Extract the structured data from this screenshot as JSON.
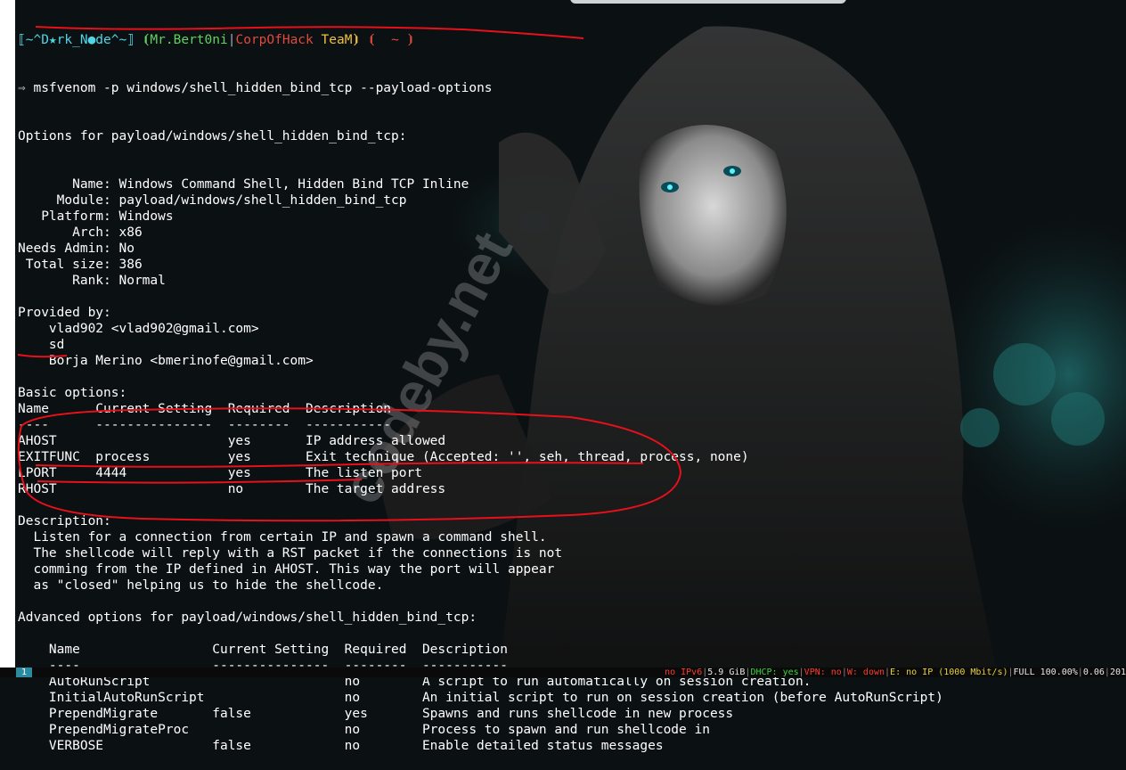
{
  "prompt": {
    "left_bracket": "⟦",
    "host": "~^D★rk_N●de^~",
    "right_bracket": "⟧",
    "user": "⦗Mr.Bert0ni",
    "team_sep": "|",
    "team": "CorpOfHack",
    "team2": " TeaM⦘",
    "cwd": " ⦗  ~ ⦘"
  },
  "command": {
    "arrow": "⇒",
    "text": "msfvenom -p windows/shell_hidden_bind_tcp --payload-options"
  },
  "lines": [
    "Options for payload/windows/shell_hidden_bind_tcp:",
    "",
    "",
    "       Name: Windows Command Shell, Hidden Bind TCP Inline",
    "     Module: payload/windows/shell_hidden_bind_tcp",
    "   Platform: Windows",
    "       Arch: x86",
    "Needs Admin: No",
    " Total size: 386",
    "       Rank: Normal",
    "",
    "Provided by:",
    "    vlad902 <vlad902@gmail.com>",
    "    sd",
    "    Borja Merino <bmerinofe@gmail.com>",
    "",
    "Basic options:",
    "Name      Current Setting  Required  Description",
    "----      ---------------  --------  -----------",
    "AHOST                      yes       IP address allowed",
    "EXITFUNC  process          yes       Exit technique (Accepted: '', seh, thread, process, none)",
    "LPORT     4444             yes       The listen port",
    "RHOST                      no        The target address",
    "",
    "Description:",
    "  Listen for a connection from certain IP and spawn a command shell.",
    "  The shellcode will reply with a RST packet if the connections is not",
    "  comming from the IP defined in AHOST. This way the port will appear",
    "  as \"closed\" helping us to hide the shellcode.",
    "",
    "Advanced options for payload/windows/shell_hidden_bind_tcp:",
    "",
    "    Name                 Current Setting  Required  Description",
    "    ----                 ---------------  --------  -----------",
    "    AutoRunScript                         no        A script to run automatically on session creation.",
    "    InitialAutoRunScript                  no        An initial script to run on session creation (before AutoRunScript)",
    "    PrependMigrate       false            yes       Spawns and runs shellcode in new process",
    "    PrependMigrateProc                    no        Process to spawn and run shellcode in",
    "    VERBOSE              false            no        Enable detailed status messages"
  ],
  "watermark": "codeby.net",
  "statusbar": {
    "workspace": "1",
    "ipv6": "no IPv6",
    "disk": "5.9 GiB",
    "dhcp": "DHCP: yes",
    "vpn": "VPN: no",
    "wifi": "W: down",
    "eth": "E: no IP (1000 Mbit/s)",
    "battery": "FULL 100.00%",
    "load": "0.06",
    "date": "201"
  },
  "colors": {
    "terminal_bg": "#0b1012",
    "text": "#ffffff",
    "prompt_cyan": "#4fd6e6",
    "prompt_green": "#5fd35f",
    "prompt_red": "#e04a3c",
    "annotation_red": "#e8101a"
  }
}
